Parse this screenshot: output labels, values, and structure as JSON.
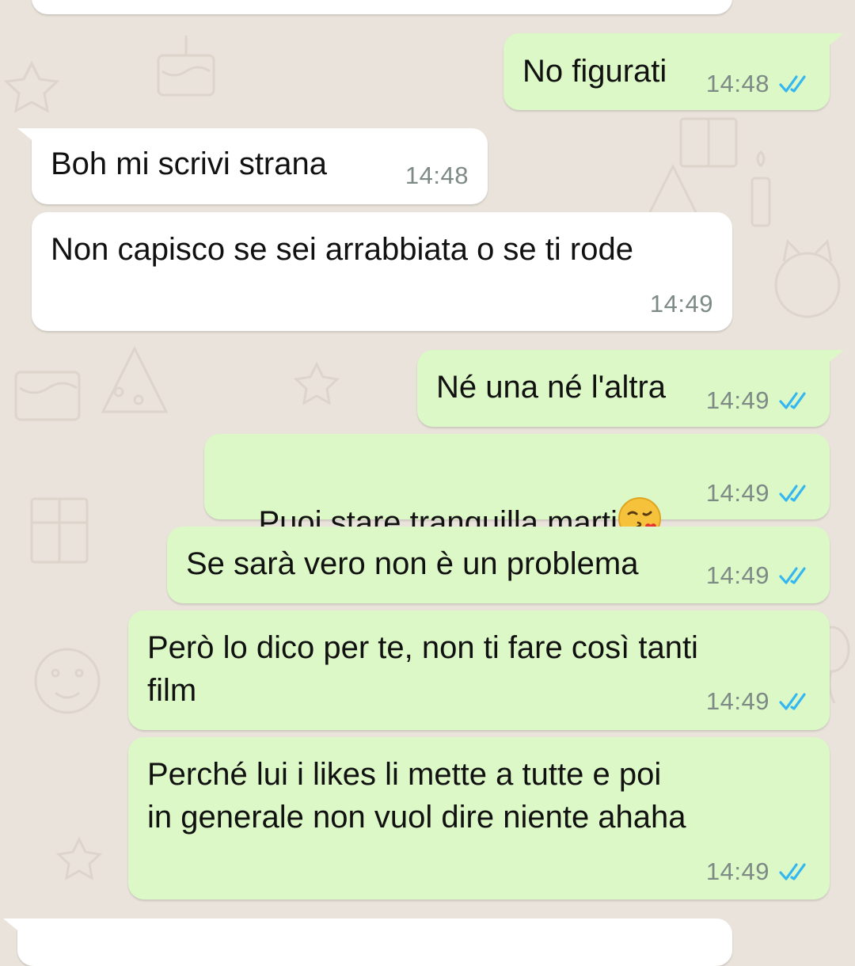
{
  "messages": [
    {
      "direction": "outgoing",
      "text": "No figurati",
      "time": "14:48",
      "read": true
    },
    {
      "direction": "incoming",
      "text": "Boh mi scrivi strana",
      "time": "14:48"
    },
    {
      "direction": "incoming",
      "text": "Non capisco se sei arrabbiata o se ti rode",
      "time": "14:49"
    },
    {
      "direction": "outgoing",
      "text": "Né una né l'altra",
      "time": "14:49",
      "read": true
    },
    {
      "direction": "outgoing",
      "text": "Puoi stare tranquilla marti",
      "emoji": "kissing-face-with-heart",
      "time": "14:49",
      "read": true
    },
    {
      "direction": "outgoing",
      "text": "Se sarà vero non è un problema",
      "time": "14:49",
      "read": true
    },
    {
      "direction": "outgoing",
      "text": "Però lo dico per te, non ti fare così tanti\nfilm",
      "time": "14:49",
      "read": true
    },
    {
      "direction": "outgoing",
      "text": "Perché lui i likes li mette a tutte e poi\nin generale non vuol dire niente ahaha",
      "time": "14:49",
      "read": true
    }
  ],
  "colors": {
    "outgoing_bubble": "#dcf8c6",
    "incoming_bubble": "#ffffff",
    "chat_background": "#e9e3db",
    "read_ticks": "#34b7f1",
    "timestamp": "#7d8a86"
  }
}
